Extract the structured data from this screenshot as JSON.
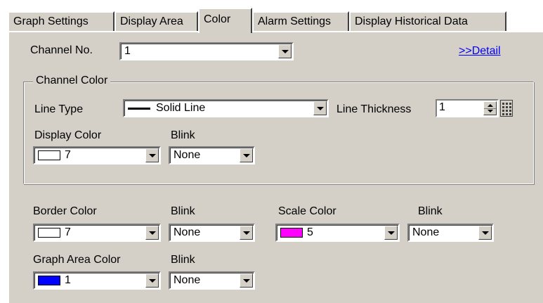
{
  "tabs": [
    "Graph Settings",
    "Display Area",
    "Color",
    "Alarm Settings",
    "Display Historical Data"
  ],
  "channel_no": {
    "label": "Channel No.",
    "value": "1"
  },
  "detail_link": ">>Detail",
  "channel_color": {
    "title": "Channel Color",
    "line_type": {
      "label": "Line Type",
      "value": "Solid Line"
    },
    "line_thickness": {
      "label": "Line Thickness",
      "value": "1"
    },
    "display_color": {
      "label": "Display Color",
      "value": "7",
      "swatch": "#ffffff"
    },
    "blink": {
      "label": "Blink",
      "value": "None"
    }
  },
  "border_color": {
    "label": "Border Color",
    "value": "7",
    "swatch": "#ffffff"
  },
  "border_blink": {
    "label": "Blink",
    "value": "None"
  },
  "scale_color": {
    "label": "Scale Color",
    "value": "5",
    "swatch": "#ff00ff"
  },
  "scale_blink": {
    "label": "Blink",
    "value": "None"
  },
  "graph_area_color": {
    "label": "Graph Area Color",
    "value": "1",
    "swatch": "#0000ff"
  },
  "graph_area_blink": {
    "label": "Blink",
    "value": "None"
  }
}
